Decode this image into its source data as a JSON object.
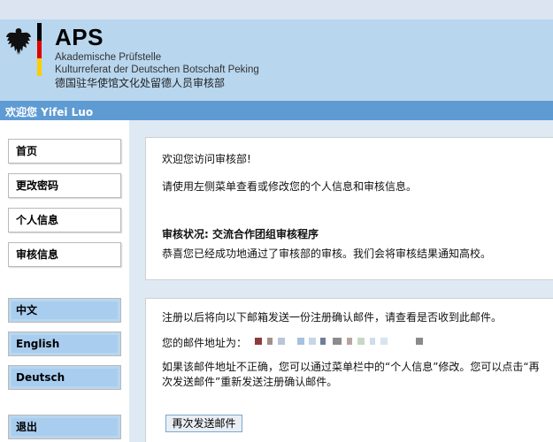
{
  "header": {
    "logo_title": "APS",
    "subtitle_line1": "Akademische Prüfstelle",
    "subtitle_line2": "Kulturreferat der Deutschen Botschaft Peking",
    "subtitle_line3": "德国驻华使馆文化处留德人员审核部",
    "colors": {
      "background": "#b8d6ee",
      "flag_black": "#000000",
      "flag_red": "#dd0000",
      "flag_gold": "#ffce00"
    }
  },
  "welcome": "欢迎您 Yifei Luo",
  "sidebar": {
    "nav": [
      {
        "label": "首页"
      },
      {
        "label": "更改密码"
      },
      {
        "label": "个人信息"
      },
      {
        "label": "审核信息"
      }
    ],
    "languages": [
      {
        "label": "中文"
      },
      {
        "label": "English"
      },
      {
        "label": "Deutsch"
      }
    ],
    "logout": "退出"
  },
  "panel1": {
    "greeting": "欢迎您访问审核部!",
    "instruction": "请使用左侧菜单查看或修改您的个人信息和审核信息。",
    "status_label": "审核状况: 交流合作团组审核程序",
    "status_message": "恭喜您已经成功地通过了审核部的审核。我们会将审核结果通知高校。"
  },
  "panel2": {
    "notice": "注册以后将向以下邮箱发送一份注册确认邮件，请查看是否收到此邮件。",
    "email_label": "您的邮件地址为：",
    "help_line1": "如果该邮件地址不正确，您可以通过菜单栏中的“个人信息”修改。您可以点击“再",
    "help_line2": "次发送邮件”重新发送注册确认邮件。",
    "resend_button": "再次发送邮件"
  }
}
